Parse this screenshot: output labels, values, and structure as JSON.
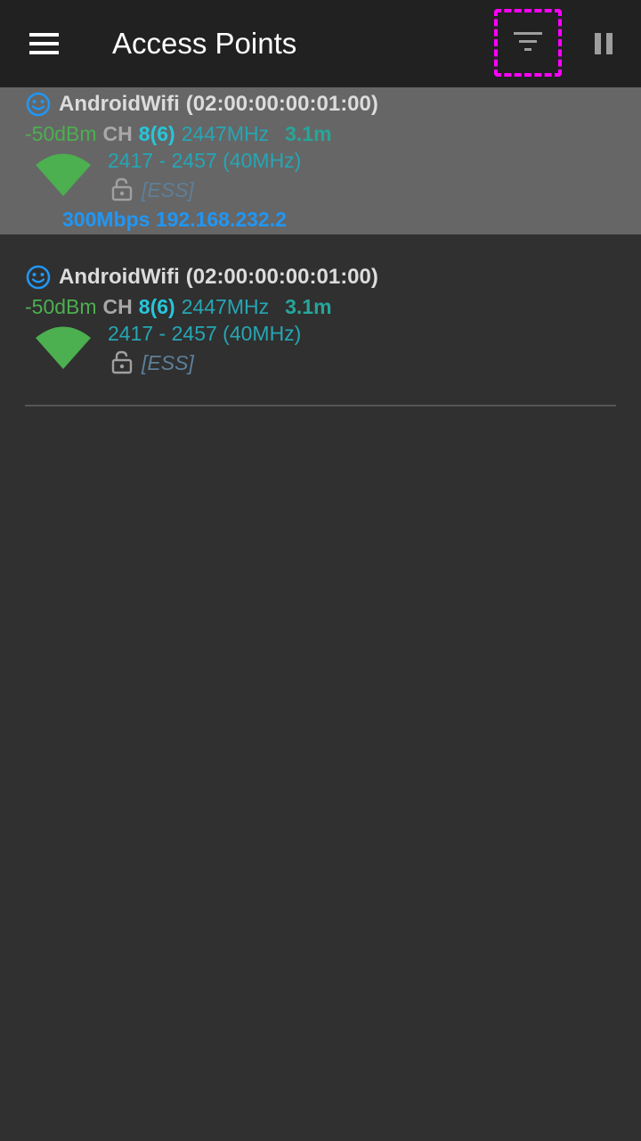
{
  "appbar": {
    "menu_icon": "hamburger-menu-icon",
    "title": "Access Points",
    "filter_icon": "filter-icon",
    "pause_icon": "pause-icon"
  },
  "colors": {
    "appbar_bg": "#212121",
    "background": "#303030",
    "connected_bg": "#666666",
    "signal_green": "#4caf50",
    "channel_cyan": "#26c6da",
    "link_blue": "#2196f3",
    "highlight": "#ff00ff"
  },
  "access_points": [
    {
      "status_icon": "smiley-icon",
      "ssid": "AndroidWifi",
      "bssid": "(02:00:00:00:01:00)",
      "level": "-50dBm",
      "ch_label": "CH",
      "channel": "8(6)",
      "frequency": "2447MHz",
      "distance": "3.1m",
      "width_range": "2417 - 2457 (40MHz)",
      "capabilities": "[ESS]",
      "link_info": "300Mbps 192.168.232.2",
      "connected": true
    },
    {
      "status_icon": "smiley-icon",
      "ssid": "AndroidWifi",
      "bssid": "(02:00:00:00:01:00)",
      "level": "-50dBm",
      "ch_label": "CH",
      "channel": "8(6)",
      "frequency": "2447MHz",
      "distance": "3.1m",
      "width_range": "2417 - 2457 (40MHz)",
      "capabilities": "[ESS]",
      "connected": false
    }
  ]
}
